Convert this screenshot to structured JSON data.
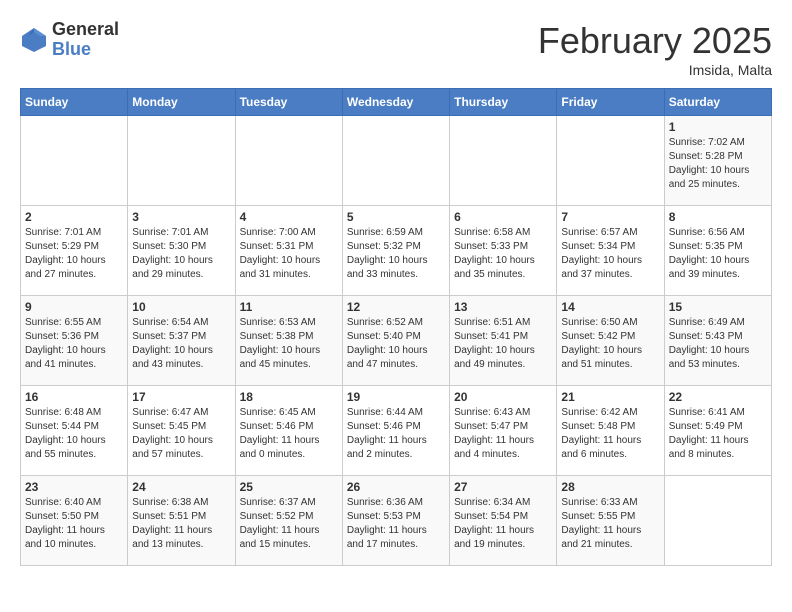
{
  "header": {
    "logo": {
      "general": "General",
      "blue": "Blue"
    },
    "title": "February 2025",
    "subtitle": "Imsida, Malta"
  },
  "weekdays": [
    "Sunday",
    "Monday",
    "Tuesday",
    "Wednesday",
    "Thursday",
    "Friday",
    "Saturday"
  ],
  "weeks": [
    [
      {
        "day": "",
        "info": ""
      },
      {
        "day": "",
        "info": ""
      },
      {
        "day": "",
        "info": ""
      },
      {
        "day": "",
        "info": ""
      },
      {
        "day": "",
        "info": ""
      },
      {
        "day": "",
        "info": ""
      },
      {
        "day": "1",
        "info": "Sunrise: 7:02 AM\nSunset: 5:28 PM\nDaylight: 10 hours\nand 25 minutes."
      }
    ],
    [
      {
        "day": "2",
        "info": "Sunrise: 7:01 AM\nSunset: 5:29 PM\nDaylight: 10 hours\nand 27 minutes."
      },
      {
        "day": "3",
        "info": "Sunrise: 7:01 AM\nSunset: 5:30 PM\nDaylight: 10 hours\nand 29 minutes."
      },
      {
        "day": "4",
        "info": "Sunrise: 7:00 AM\nSunset: 5:31 PM\nDaylight: 10 hours\nand 31 minutes."
      },
      {
        "day": "5",
        "info": "Sunrise: 6:59 AM\nSunset: 5:32 PM\nDaylight: 10 hours\nand 33 minutes."
      },
      {
        "day": "6",
        "info": "Sunrise: 6:58 AM\nSunset: 5:33 PM\nDaylight: 10 hours\nand 35 minutes."
      },
      {
        "day": "7",
        "info": "Sunrise: 6:57 AM\nSunset: 5:34 PM\nDaylight: 10 hours\nand 37 minutes."
      },
      {
        "day": "8",
        "info": "Sunrise: 6:56 AM\nSunset: 5:35 PM\nDaylight: 10 hours\nand 39 minutes."
      }
    ],
    [
      {
        "day": "9",
        "info": "Sunrise: 6:55 AM\nSunset: 5:36 PM\nDaylight: 10 hours\nand 41 minutes."
      },
      {
        "day": "10",
        "info": "Sunrise: 6:54 AM\nSunset: 5:37 PM\nDaylight: 10 hours\nand 43 minutes."
      },
      {
        "day": "11",
        "info": "Sunrise: 6:53 AM\nSunset: 5:38 PM\nDaylight: 10 hours\nand 45 minutes."
      },
      {
        "day": "12",
        "info": "Sunrise: 6:52 AM\nSunset: 5:40 PM\nDaylight: 10 hours\nand 47 minutes."
      },
      {
        "day": "13",
        "info": "Sunrise: 6:51 AM\nSunset: 5:41 PM\nDaylight: 10 hours\nand 49 minutes."
      },
      {
        "day": "14",
        "info": "Sunrise: 6:50 AM\nSunset: 5:42 PM\nDaylight: 10 hours\nand 51 minutes."
      },
      {
        "day": "15",
        "info": "Sunrise: 6:49 AM\nSunset: 5:43 PM\nDaylight: 10 hours\nand 53 minutes."
      }
    ],
    [
      {
        "day": "16",
        "info": "Sunrise: 6:48 AM\nSunset: 5:44 PM\nDaylight: 10 hours\nand 55 minutes."
      },
      {
        "day": "17",
        "info": "Sunrise: 6:47 AM\nSunset: 5:45 PM\nDaylight: 10 hours\nand 57 minutes."
      },
      {
        "day": "18",
        "info": "Sunrise: 6:45 AM\nSunset: 5:46 PM\nDaylight: 11 hours\nand 0 minutes."
      },
      {
        "day": "19",
        "info": "Sunrise: 6:44 AM\nSunset: 5:46 PM\nDaylight: 11 hours\nand 2 minutes."
      },
      {
        "day": "20",
        "info": "Sunrise: 6:43 AM\nSunset: 5:47 PM\nDaylight: 11 hours\nand 4 minutes."
      },
      {
        "day": "21",
        "info": "Sunrise: 6:42 AM\nSunset: 5:48 PM\nDaylight: 11 hours\nand 6 minutes."
      },
      {
        "day": "22",
        "info": "Sunrise: 6:41 AM\nSunset: 5:49 PM\nDaylight: 11 hours\nand 8 minutes."
      }
    ],
    [
      {
        "day": "23",
        "info": "Sunrise: 6:40 AM\nSunset: 5:50 PM\nDaylight: 11 hours\nand 10 minutes."
      },
      {
        "day": "24",
        "info": "Sunrise: 6:38 AM\nSunset: 5:51 PM\nDaylight: 11 hours\nand 13 minutes."
      },
      {
        "day": "25",
        "info": "Sunrise: 6:37 AM\nSunset: 5:52 PM\nDaylight: 11 hours\nand 15 minutes."
      },
      {
        "day": "26",
        "info": "Sunrise: 6:36 AM\nSunset: 5:53 PM\nDaylight: 11 hours\nand 17 minutes."
      },
      {
        "day": "27",
        "info": "Sunrise: 6:34 AM\nSunset: 5:54 PM\nDaylight: 11 hours\nand 19 minutes."
      },
      {
        "day": "28",
        "info": "Sunrise: 6:33 AM\nSunset: 5:55 PM\nDaylight: 11 hours\nand 21 minutes."
      },
      {
        "day": "",
        "info": ""
      }
    ]
  ]
}
